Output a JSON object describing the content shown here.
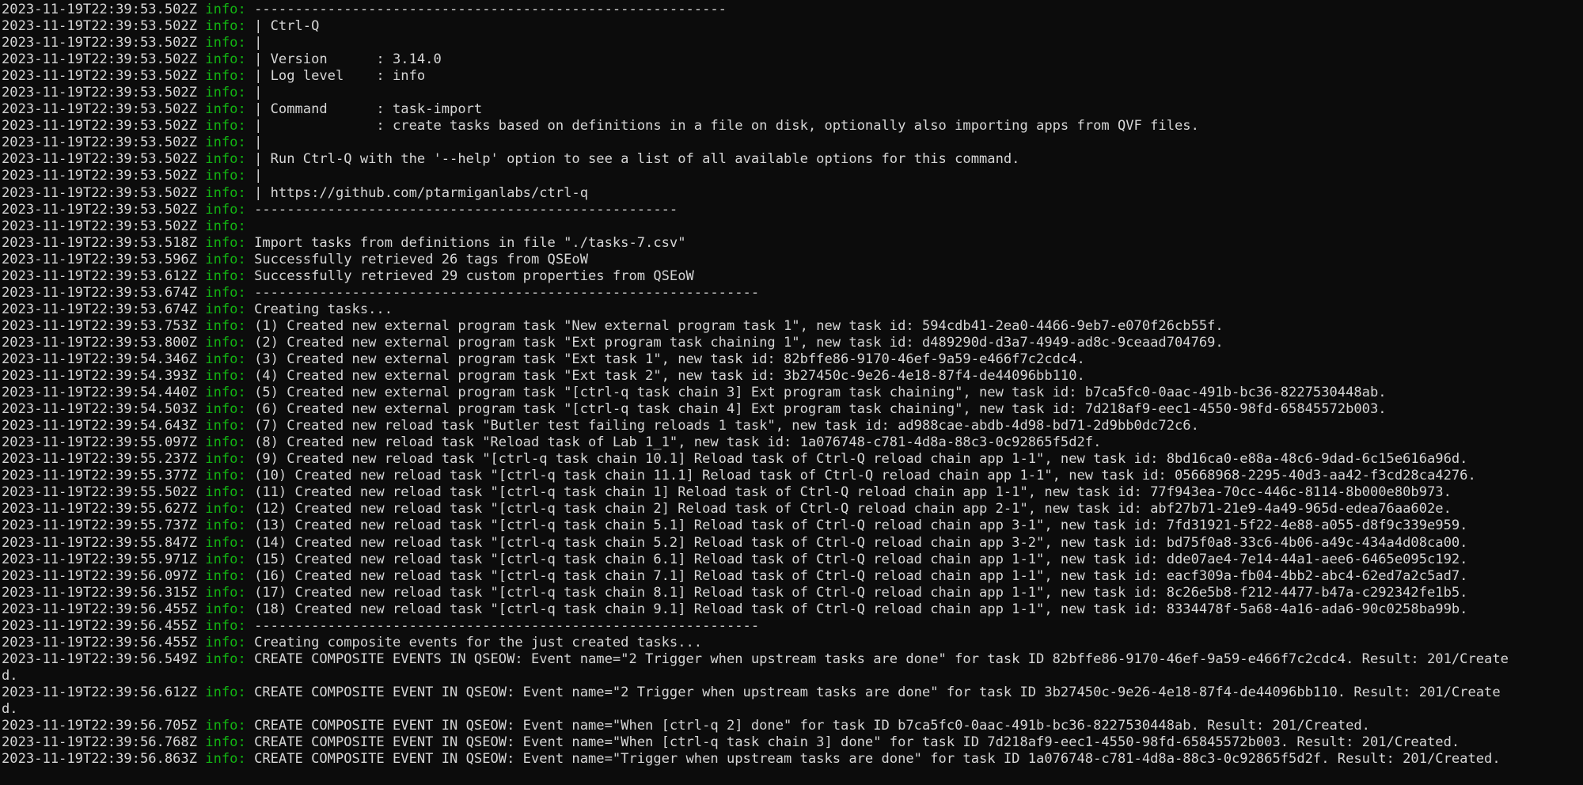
{
  "terminal": {
    "title": "Terminal — ctrl-q task-import",
    "background_color": "#0c0c0c",
    "text_color": "#d6d6d6",
    "level_color": "#12b512",
    "level_label": "info:",
    "font_size_px": 17,
    "columns": 117,
    "rows": 47
  },
  "log_lines": [
    {
      "ts": "2023-11-19T22:39:53.502Z",
      "level": "info:",
      "msg": "----------------------------------------------------------"
    },
    {
      "ts": "2023-11-19T22:39:53.502Z",
      "level": "info:",
      "msg": "| Ctrl-Q"
    },
    {
      "ts": "2023-11-19T22:39:53.502Z",
      "level": "info:",
      "msg": "|"
    },
    {
      "ts": "2023-11-19T22:39:53.502Z",
      "level": "info:",
      "msg": "| Version      : 3.14.0"
    },
    {
      "ts": "2023-11-19T22:39:53.502Z",
      "level": "info:",
      "msg": "| Log level    : info"
    },
    {
      "ts": "2023-11-19T22:39:53.502Z",
      "level": "info:",
      "msg": "|"
    },
    {
      "ts": "2023-11-19T22:39:53.502Z",
      "level": "info:",
      "msg": "| Command      : task-import"
    },
    {
      "ts": "2023-11-19T22:39:53.502Z",
      "level": "info:",
      "msg": "|              : create tasks based on definitions in a file on disk, optionally also importing apps from QVF files."
    },
    {
      "ts": "2023-11-19T22:39:53.502Z",
      "level": "info:",
      "msg": "|"
    },
    {
      "ts": "2023-11-19T22:39:53.502Z",
      "level": "info:",
      "msg": "| Run Ctrl-Q with the '--help' option to see a list of all available options for this command."
    },
    {
      "ts": "2023-11-19T22:39:53.502Z",
      "level": "info:",
      "msg": "|"
    },
    {
      "ts": "2023-11-19T22:39:53.502Z",
      "level": "info:",
      "msg": "| https://github.com/ptarmiganlabs/ctrl-q"
    },
    {
      "ts": "2023-11-19T22:39:53.502Z",
      "level": "info:",
      "msg": "----------------------------------------------------"
    },
    {
      "ts": "2023-11-19T22:39:53.502Z",
      "level": "info:",
      "msg": ""
    },
    {
      "ts": "2023-11-19T22:39:53.518Z",
      "level": "info:",
      "msg": "Import tasks from definitions in file \"./tasks-7.csv\""
    },
    {
      "ts": "2023-11-19T22:39:53.596Z",
      "level": "info:",
      "msg": "Successfully retrieved 26 tags from QSEoW"
    },
    {
      "ts": "2023-11-19T22:39:53.612Z",
      "level": "info:",
      "msg": "Successfully retrieved 29 custom properties from QSEoW"
    },
    {
      "ts": "2023-11-19T22:39:53.674Z",
      "level": "info:",
      "msg": "--------------------------------------------------------------"
    },
    {
      "ts": "2023-11-19T22:39:53.674Z",
      "level": "info:",
      "msg": "Creating tasks..."
    },
    {
      "ts": "2023-11-19T22:39:53.753Z",
      "level": "info:",
      "msg": "(1) Created new external program task \"New external program task 1\", new task id: 594cdb41-2ea0-4466-9eb7-e070f26cb55f."
    },
    {
      "ts": "2023-11-19T22:39:53.800Z",
      "level": "info:",
      "msg": "(2) Created new external program task \"Ext program task chaining 1\", new task id: d489290d-d3a7-4949-ad8c-9ceaad704769."
    },
    {
      "ts": "2023-11-19T22:39:54.346Z",
      "level": "info:",
      "msg": "(3) Created new external program task \"Ext task 1\", new task id: 82bffe86-9170-46ef-9a59-e466f7c2cdc4."
    },
    {
      "ts": "2023-11-19T22:39:54.393Z",
      "level": "info:",
      "msg": "(4) Created new external program task \"Ext task 2\", new task id: 3b27450c-9e26-4e18-87f4-de44096bb110."
    },
    {
      "ts": "2023-11-19T22:39:54.440Z",
      "level": "info:",
      "msg": "(5) Created new external program task \"[ctrl-q task chain 3] Ext program task chaining\", new task id: b7ca5fc0-0aac-491b-bc36-8227530448ab."
    },
    {
      "ts": "2023-11-19T22:39:54.503Z",
      "level": "info:",
      "msg": "(6) Created new external program task \"[ctrl-q task chain 4] Ext program task chaining\", new task id: 7d218af9-eec1-4550-98fd-65845572b003."
    },
    {
      "ts": "2023-11-19T22:39:54.643Z",
      "level": "info:",
      "msg": "(7) Created new reload task \"Butler test failing reloads 1 task\", new task id: ad988cae-abdb-4d98-bd71-2d9bb0dc72c6."
    },
    {
      "ts": "2023-11-19T22:39:55.097Z",
      "level": "info:",
      "msg": "(8) Created new reload task \"Reload task of Lab 1_1\", new task id: 1a076748-c781-4d8a-88c3-0c92865f5d2f."
    },
    {
      "ts": "2023-11-19T22:39:55.237Z",
      "level": "info:",
      "msg": "(9) Created new reload task \"[ctrl-q task chain 10.1] Reload task of Ctrl-Q reload chain app 1-1\", new task id: 8bd16ca0-e88a-48c6-9dad-6c15e616a96d."
    },
    {
      "ts": "2023-11-19T22:39:55.377Z",
      "level": "info:",
      "msg": "(10) Created new reload task \"[ctrl-q task chain 11.1] Reload task of Ctrl-Q reload chain app 1-1\", new task id: 05668968-2295-40d3-aa42-f3cd28ca4276."
    },
    {
      "ts": "2023-11-19T22:39:55.502Z",
      "level": "info:",
      "msg": "(11) Created new reload task \"[ctrl-q task chain 1] Reload task of Ctrl-Q reload chain app 1-1\", new task id: 77f943ea-70cc-446c-8114-8b000e80b973."
    },
    {
      "ts": "2023-11-19T22:39:55.627Z",
      "level": "info:",
      "msg": "(12) Created new reload task \"[ctrl-q task chain 2] Reload task of Ctrl-Q reload chain app 2-1\", new task id: abf27b71-21e9-4a49-965d-edea76aa602e."
    },
    {
      "ts": "2023-11-19T22:39:55.737Z",
      "level": "info:",
      "msg": "(13) Created new reload task \"[ctrl-q task chain 5.1] Reload task of Ctrl-Q reload chain app 3-1\", new task id: 7fd31921-5f22-4e88-a055-d8f9c339e959."
    },
    {
      "ts": "2023-11-19T22:39:55.847Z",
      "level": "info:",
      "msg": "(14) Created new reload task \"[ctrl-q task chain 5.2] Reload task of Ctrl-Q reload chain app 3-2\", new task id: bd75f0a8-33c6-4b06-a49c-434a4d08ca00."
    },
    {
      "ts": "2023-11-19T22:39:55.971Z",
      "level": "info:",
      "msg": "(15) Created new reload task \"[ctrl-q task chain 6.1] Reload task of Ctrl-Q reload chain app 1-1\", new task id: dde07ae4-7e14-44a1-aee6-6465e095c192."
    },
    {
      "ts": "2023-11-19T22:39:56.097Z",
      "level": "info:",
      "msg": "(16) Created new reload task \"[ctrl-q task chain 7.1] Reload task of Ctrl-Q reload chain app 1-1\", new task id: eacf309a-fb04-4bb2-abc4-62ed7a2c5ad7."
    },
    {
      "ts": "2023-11-19T22:39:56.315Z",
      "level": "info:",
      "msg": "(17) Created new reload task \"[ctrl-q task chain 8.1] Reload task of Ctrl-Q reload chain app 1-1\", new task id: 8c26e5b8-f212-4477-b47a-c292342fe1b5."
    },
    {
      "ts": "2023-11-19T22:39:56.455Z",
      "level": "info:",
      "msg": "(18) Created new reload task \"[ctrl-q task chain 9.1] Reload task of Ctrl-Q reload chain app 1-1\", new task id: 8334478f-5a68-4a16-ada6-90c0258ba99b."
    },
    {
      "ts": "2023-11-19T22:39:56.455Z",
      "level": "info:",
      "msg": "--------------------------------------------------------------"
    },
    {
      "ts": "2023-11-19T22:39:56.455Z",
      "level": "info:",
      "msg": "Creating composite events for the just created tasks..."
    },
    {
      "ts": "2023-11-19T22:39:56.549Z",
      "level": "info:",
      "msg": "CREATE COMPOSITE EVENTS IN QSEOW: Event name=\"2 Trigger when upstream tasks are done\" for task ID 82bffe86-9170-46ef-9a59-e466f7c2cdc4. Result: 201/Create",
      "cont": "d."
    },
    {
      "ts": "2023-11-19T22:39:56.612Z",
      "level": "info:",
      "msg": "CREATE COMPOSITE EVENT IN QSEOW: Event name=\"2 Trigger when upstream tasks are done\" for task ID 3b27450c-9e26-4e18-87f4-de44096bb110. Result: 201/Create",
      "cont": "d."
    },
    {
      "ts": "2023-11-19T22:39:56.705Z",
      "level": "info:",
      "msg": "CREATE COMPOSITE EVENT IN QSEOW: Event name=\"When [ctrl-q 2] done\" for task ID b7ca5fc0-0aac-491b-bc36-8227530448ab. Result: 201/Created."
    },
    {
      "ts": "2023-11-19T22:39:56.768Z",
      "level": "info:",
      "msg": "CREATE COMPOSITE EVENT IN QSEOW: Event name=\"When [ctrl-q task chain 3] done\" for task ID 7d218af9-eec1-4550-98fd-65845572b003. Result: 201/Created."
    },
    {
      "ts": "2023-11-19T22:39:56.863Z",
      "level": "info:",
      "msg": "CREATE COMPOSITE EVENT IN QSEOW: Event name=\"Trigger when upstream tasks are done\" for task ID 1a076748-c781-4d8a-88c3-0c92865f5d2f. Result: 201/Created."
    }
  ]
}
